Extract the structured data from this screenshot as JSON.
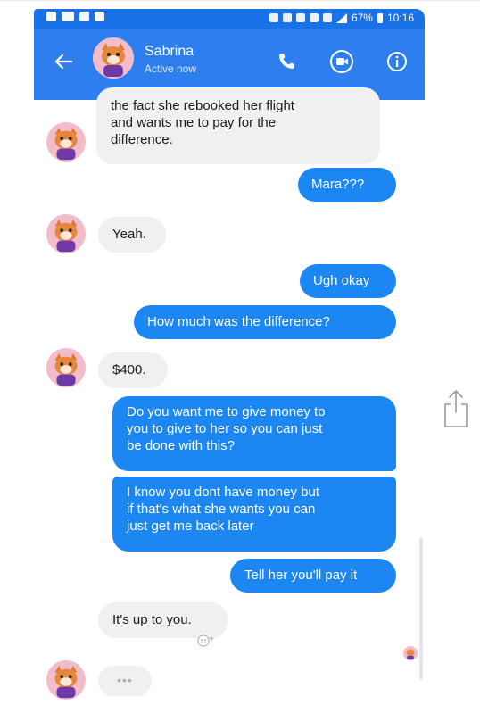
{
  "statusbar": {
    "battery": "67%",
    "time": "10:16"
  },
  "header": {
    "contact_name": "Sabrina",
    "contact_status": "Active now",
    "back_icon": "arrow-left-icon",
    "call_icon": "phone-icon",
    "video_icon": "video-camera-icon",
    "info_icon": "info-icon"
  },
  "messages": [
    {
      "from": "them",
      "lines": [
        "the fact she rebooked her flight",
        "and wants me to pay for the",
        "difference."
      ]
    },
    {
      "from": "me",
      "text": "Mara???"
    },
    {
      "from": "them",
      "text": "Yeah."
    },
    {
      "from": "me",
      "text": "Ugh okay"
    },
    {
      "from": "me",
      "text": "How much was the difference?"
    },
    {
      "from": "them",
      "text": "$400."
    },
    {
      "from": "me",
      "lines": [
        "Do you want me to give money to",
        "you to give to her so you can just",
        "be done with this?"
      ]
    },
    {
      "from": "me",
      "lines": [
        "I know you dont have money but",
        "if that's what she wants you can",
        "just get me back later"
      ]
    },
    {
      "from": "me",
      "text": "Tell her you'll pay it"
    },
    {
      "from": "them",
      "text": "It's up to you."
    }
  ],
  "typing_indicator": "•••",
  "colors": {
    "header": "#2d7ff0",
    "statusbar": "#1a72e8",
    "outgoing": "#1c86f2",
    "incoming": "#f1f0f0"
  }
}
